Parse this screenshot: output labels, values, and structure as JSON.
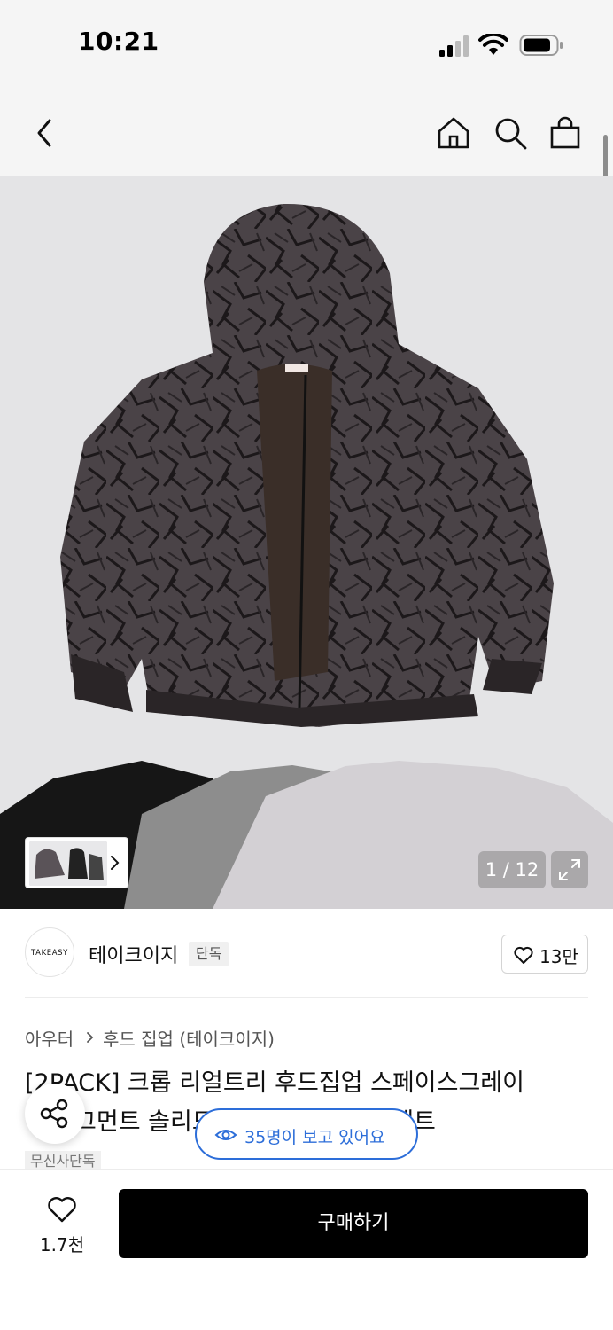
{
  "status_bar": {
    "time": "10:21"
  },
  "gallery": {
    "counter": "1 / 12",
    "brand_label_on_product": "TAKEASY"
  },
  "brand": {
    "logo_text": "TAKEASY",
    "name": "테이크이지",
    "badge": "단독",
    "likes": "13만"
  },
  "breadcrumb": {
    "category": "아우터",
    "subcategory": "후드 집업 (테이크이지)"
  },
  "product": {
    "title_line1": "[2PACK] 크롭 리얼트리 후드집업 스페이스그레이",
    "title_line2": "+ 피그먼트 솔리드 크롭 티셔츠 3종 세트",
    "exclusive_tag": "무신사단독"
  },
  "viewers_pill": {
    "text": "35명이 보고 있어요"
  },
  "bottom_bar": {
    "wish_count": "1.7천",
    "buy_label": "구매하기"
  },
  "colors": {
    "accent_blue": "#2d6ed9",
    "buy_button": "#000000"
  }
}
